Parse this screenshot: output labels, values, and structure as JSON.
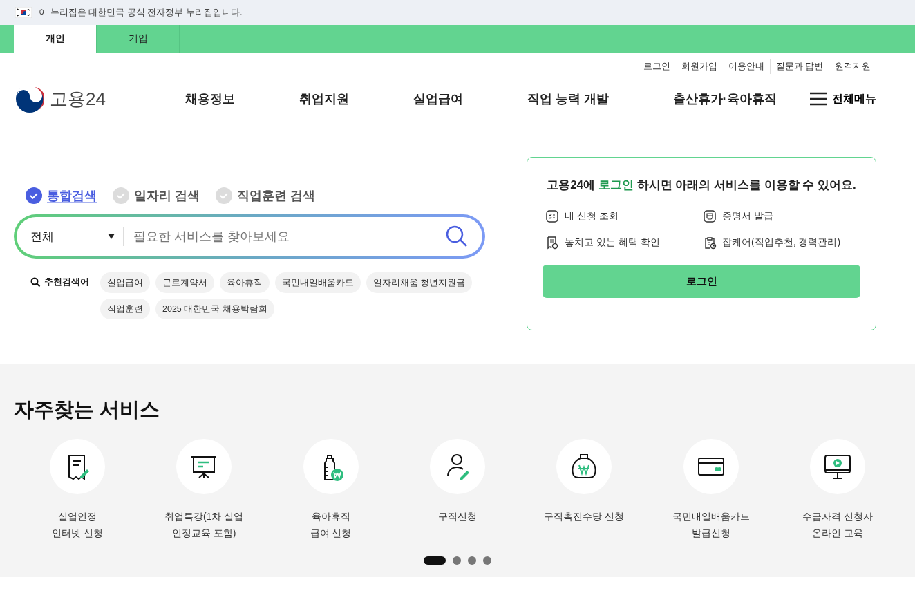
{
  "notice": {
    "text": "이 누리집은 대한민국 공식 전자정부 누리집입니다."
  },
  "audience_tabs": [
    {
      "label": "개인",
      "selected": true
    },
    {
      "label": "기업",
      "selected": false
    }
  ],
  "utility_links": [
    {
      "label": "로그인",
      "separated": false
    },
    {
      "label": "회원가입",
      "separated": false
    },
    {
      "label": "이용안내",
      "separated": false
    },
    {
      "label": "질문과 답변",
      "separated": true
    },
    {
      "label": "원격지원",
      "separated": true
    }
  ],
  "logo": {
    "text": "고용24"
  },
  "nav": [
    "채용정보",
    "취업지원",
    "실업급여",
    "직업 능력 개발",
    "출산휴가·육아휴직"
  ],
  "all_menu": {
    "label": "전체메뉴"
  },
  "search_types": [
    {
      "label": "통합검색",
      "selected": true
    },
    {
      "label": "일자리 검색",
      "selected": false
    },
    {
      "label": "직업훈련 검색",
      "selected": false
    }
  ],
  "search": {
    "scope": "전체",
    "placeholder": "필요한 서비스를 찾아보세요"
  },
  "recommended": {
    "label": "추천검색어",
    "keywords": [
      "실업급여",
      "근로계약서",
      "육아휴직",
      "국민내일배움카드",
      "일자리채움 청년지원금",
      "직업훈련",
      "2025 대한민국 채용박람회"
    ]
  },
  "login_card": {
    "title_prefix": "고용24에 ",
    "title_highlight": "로그인",
    "title_suffix": " 하시면 아래의 서비스를 이용할 수 있어요.",
    "services": [
      "내 신청 조회",
      "증명서 발급",
      "놓치고 있는 혜택 확인",
      "잡케어(직업추천, 경력관리)"
    ],
    "button": "로그인"
  },
  "frequent": {
    "title": "자주찾는 서비스",
    "services": [
      {
        "lines": [
          "실업인정",
          "인터넷 신청"
        ]
      },
      {
        "lines": [
          "취업특강(1차 실업",
          "인정교육 포함)"
        ]
      },
      {
        "lines": [
          "육아휴직",
          "급여 신청"
        ]
      },
      {
        "lines": [
          "구직신청"
        ]
      },
      {
        "lines": [
          "구직촉진수당 신청"
        ]
      },
      {
        "lines": [
          "국민내일배움카드",
          "발급신청"
        ]
      },
      {
        "lines": [
          "수급자격 신청자",
          "온라인 교육"
        ]
      }
    ],
    "pages": [
      {
        "selected": true
      },
      {
        "selected": false
      },
      {
        "selected": false
      },
      {
        "selected": false
      }
    ]
  }
}
